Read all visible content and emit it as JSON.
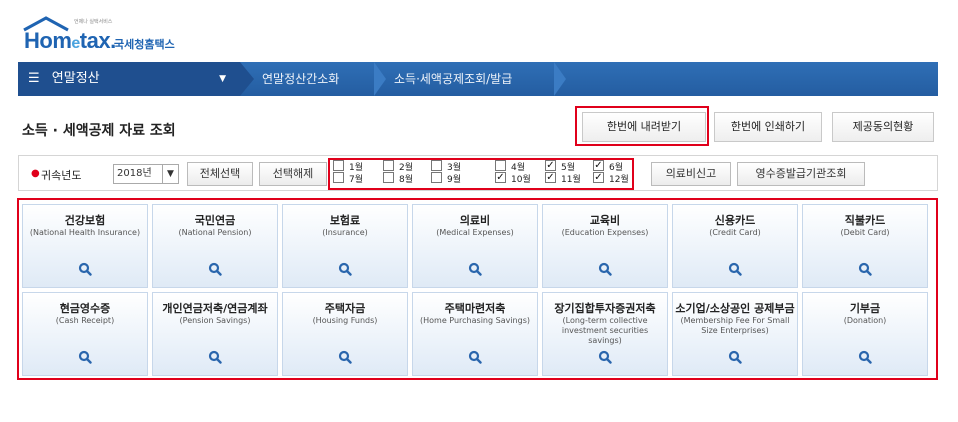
{
  "logo": {
    "brand": "Hometax",
    "sub": "국세청홈택스",
    "tiny": "언제나 실택서비스"
  },
  "nav": {
    "menu_icon": "hamburger-icon",
    "current": "연말정산",
    "crumbs": [
      "연말정산간소화",
      "소득·세액공제조회/발급"
    ]
  },
  "page_title": "소득 · 세액공제 자료 조회",
  "actions": {
    "download_all": "한번에 내려받기",
    "print_all": "한번에 인쇄하기",
    "consent": "제공동의현황"
  },
  "filter": {
    "label": "귀속년도",
    "year": "2018년",
    "select_all": "전체선택",
    "deselect": "선택해제",
    "months": [
      {
        "label": "1월",
        "checked": false
      },
      {
        "label": "2월",
        "checked": false
      },
      {
        "label": "3월",
        "checked": false
      },
      {
        "label": "4월",
        "checked": false
      },
      {
        "label": "5월",
        "checked": true
      },
      {
        "label": "6월",
        "checked": true
      },
      {
        "label": "7월",
        "checked": false
      },
      {
        "label": "8월",
        "checked": false
      },
      {
        "label": "9월",
        "checked": false
      },
      {
        "label": "10월",
        "checked": true
      },
      {
        "label": "11월",
        "checked": true
      },
      {
        "label": "12월",
        "checked": true
      }
    ],
    "medical_report": "의료비신고",
    "receipt_issuer": "영수증발급기관조회"
  },
  "cards": [
    {
      "ko": "건강보험",
      "en": "(National Health Insurance)"
    },
    {
      "ko": "국민연금",
      "en": "(National Pension)"
    },
    {
      "ko": "보험료",
      "en": "(Insurance)"
    },
    {
      "ko": "의료비",
      "en": "(Medical Expenses)"
    },
    {
      "ko": "교육비",
      "en": "(Education Expenses)"
    },
    {
      "ko": "신용카드",
      "en": "(Credit Card)"
    },
    {
      "ko": "직불카드",
      "en": "(Debit Card)"
    },
    {
      "ko": "현금영수증",
      "en": "(Cash Receipt)"
    },
    {
      "ko": "개인연금저축/연금계좌",
      "en": "(Pension Savings)"
    },
    {
      "ko": "주택자금",
      "en": "(Housing Funds)"
    },
    {
      "ko": "주택마련저축",
      "en": "(Home Purchasing Savings)"
    },
    {
      "ko": "장기집합투자증권저축",
      "en": "(Long-term collective investment securities savings)"
    },
    {
      "ko": "소기업/소상공인 공제부금",
      "en": "(Membership Fee For Small Size Enterprises)"
    },
    {
      "ko": "기부금",
      "en": "(Donation)"
    }
  ],
  "colors": {
    "nav": "#2a66ad",
    "highlight": "#e0001b",
    "card_bottom": "#dfeaf6"
  }
}
